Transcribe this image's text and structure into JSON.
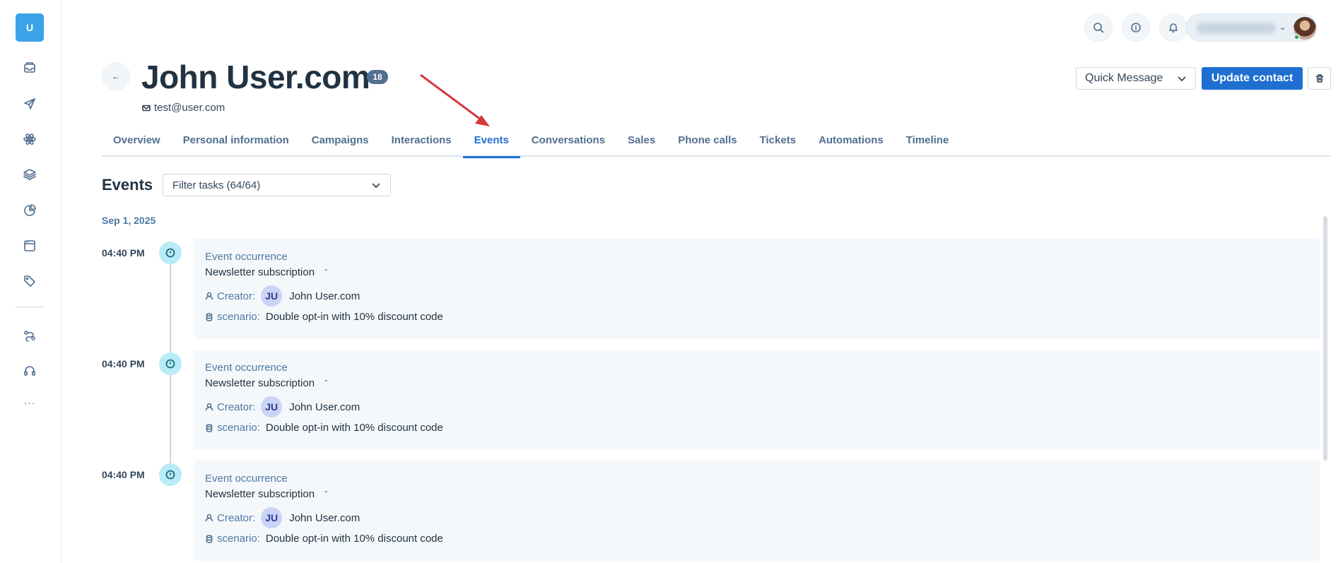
{
  "sidebar": {
    "logo_letter": "U",
    "icons": [
      "inbox-icon",
      "send-icon",
      "atom-icon",
      "layers-icon",
      "pie-chart-icon",
      "browser-window-icon",
      "tags-icon",
      "route-icon",
      "headset-icon"
    ],
    "more_label": "···"
  },
  "topbar": {
    "icons": [
      "search-icon",
      "info-icon",
      "bell-icon"
    ]
  },
  "contact": {
    "name": "John User.com",
    "badge": "18",
    "email": "test@user.com"
  },
  "actions": {
    "quick_message": "Quick Message",
    "update_contact": "Update contact"
  },
  "tabs": [
    {
      "label": "Overview"
    },
    {
      "label": "Personal information"
    },
    {
      "label": "Campaigns"
    },
    {
      "label": "Interactions"
    },
    {
      "label": "Events",
      "active": true
    },
    {
      "label": "Conversations"
    },
    {
      "label": "Sales"
    },
    {
      "label": "Phone calls"
    },
    {
      "label": "Tickets"
    },
    {
      "label": "Automations"
    },
    {
      "label": "Timeline"
    }
  ],
  "events": {
    "title": "Events",
    "filter": "Filter tasks (64/64)",
    "date": "Sep 1, 2025",
    "items": [
      {
        "time": "04:40 PM",
        "type": "Event occurrence",
        "name": "Newsletter subscription",
        "creator_label": "Creator:",
        "creator_initials": "JU",
        "creator_name": "John User.com",
        "scenario_label": "scenario:",
        "scenario_value": "Double opt-in with 10% discount code"
      },
      {
        "time": "04:40 PM",
        "type": "Event occurrence",
        "name": "Newsletter subscription",
        "creator_label": "Creator:",
        "creator_initials": "JU",
        "creator_name": "John User.com",
        "scenario_label": "scenario:",
        "scenario_value": "Double opt-in with 10% discount code"
      },
      {
        "time": "04:40 PM",
        "type": "Event occurrence",
        "name": "Newsletter subscription",
        "creator_label": "Creator:",
        "creator_initials": "JU",
        "creator_name": "John User.com",
        "scenario_label": "scenario:",
        "scenario_value": "Double opt-in with 10% discount code"
      }
    ]
  },
  "colors": {
    "primary": "#1f6fd1",
    "logo": "#3ba3e8",
    "annotation_arrow": "#d33a3a",
    "timeline_dot": "#b7ecf6"
  }
}
